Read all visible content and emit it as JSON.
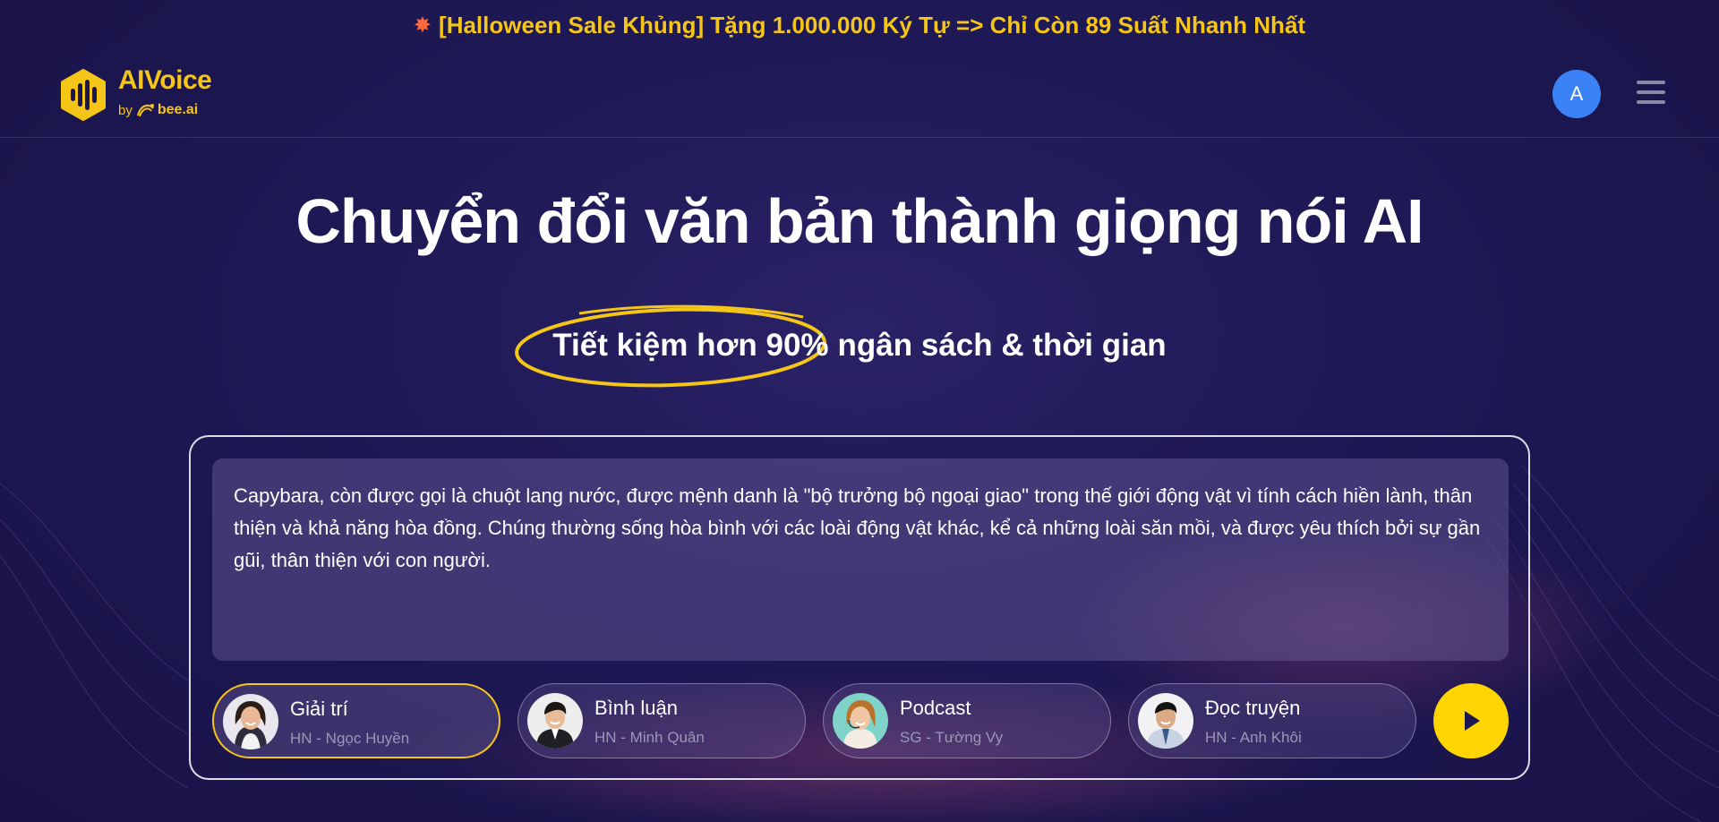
{
  "promo": {
    "icon": "sparkle-icon",
    "text": "[Halloween Sale Khủng] Tặng 1.000.000 Ký Tự => Chỉ Còn 89 Suất Nhanh Nhất"
  },
  "brand": {
    "name": "AIVoice",
    "by": "by",
    "partner": "bee.ai",
    "color": "#f5c518"
  },
  "user": {
    "initial": "A",
    "avatar_color": "#3b82f6"
  },
  "hero": {
    "title": "Chuyển đổi văn bản thành giọng nói AI",
    "highlight": "Tiết kiệm hơn 90%",
    "rest": "ngân sách & thời gian"
  },
  "editor": {
    "text": "Capybara, còn được gọi là chuột lang nước, được mệnh danh là \"bộ trưởng bộ ngoại giao\" trong thế giới động vật vì tính cách hiền lành, thân thiện và khả năng hòa đồng. Chúng thường sống hòa bình với các loài động vật khác, kể cả những loài săn mồi, và được yêu thích bởi sự gần gũi, thân thiện với con người."
  },
  "voices": [
    {
      "label": "Giải trí",
      "speaker": "HN - Ngọc Huyền",
      "selected": true
    },
    {
      "label": "Bình luận",
      "speaker": "HN - Minh Quân",
      "selected": false
    },
    {
      "label": "Podcast",
      "speaker": "SG - Tường Vy",
      "selected": false
    },
    {
      "label": "Đọc truyện",
      "speaker": "HN - Anh Khôi",
      "selected": false
    }
  ],
  "colors": {
    "accent": "#ffd500",
    "background": "#1c1650",
    "selected_border": "#f5c518"
  }
}
